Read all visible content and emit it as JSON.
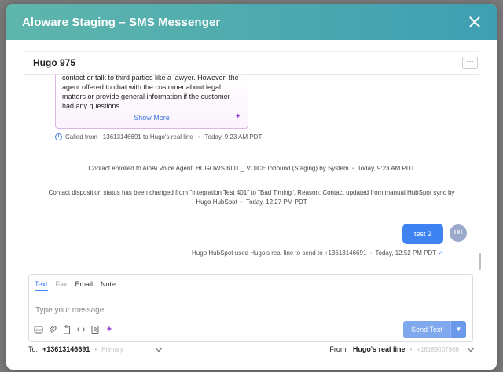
{
  "header": {
    "title": "Aloware Staging – SMS Messenger"
  },
  "contact": {
    "name": "Hugo 975",
    "more_label": "···"
  },
  "summary": {
    "text": "contact or talk to third parties like a lawyer. However, the agent offered to chat with the customer about legal matters or provide general information if the customer had any questions.",
    "show_more": "Show More"
  },
  "call_info": {
    "text": "Called from +13613146691  to Hugo's real line",
    "time": "Today, 9:23 AM PDT"
  },
  "events": [
    {
      "text": "Contact enrolled to AloAi Voice Agent: HUGOWS BOT _ VOICE Inbound (Staging) by System",
      "time": "Today, 9:23 AM PDT"
    },
    {
      "text": "Contact disposition status has been changed from \"Integration Test 401\" to \"Bad Timing\". Reason: Contact updated from manual HubSpot sync by Hugo HubSpot",
      "time": "Today, 12:27 PM PDT"
    }
  ],
  "message": {
    "text": "test 2",
    "avatar": "HH",
    "info": "Hugo HubSpot used Hugo's real line to send to +13613146691",
    "time": "Today, 12:52 PM PDT"
  },
  "composer": {
    "tabs": [
      "Text",
      "Fax",
      "Email",
      "Note"
    ],
    "placeholder": "Type your message",
    "send_label": "Send Text"
  },
  "footer": {
    "to_label": "To:",
    "to_number": "+13613146691",
    "to_tag": "Primary",
    "from_label": "From:",
    "from_line": "Hugo's real line",
    "from_number": "+18189007986"
  },
  "colors": {
    "accent": "#3f83f2",
    "header_start": "#5fb6ac",
    "header_end": "#3e9fb2",
    "ai": "#9b47d9"
  }
}
